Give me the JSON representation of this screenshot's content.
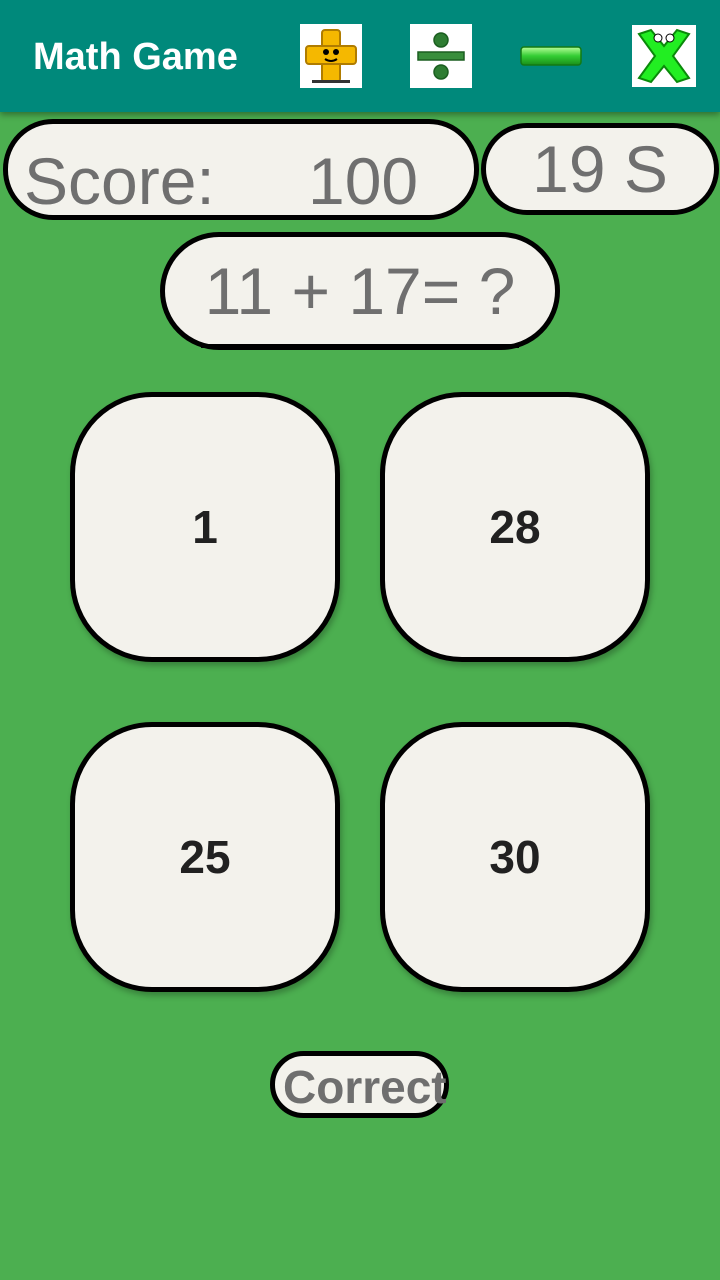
{
  "app": {
    "title": "Math Game"
  },
  "toolbar": {
    "icons": [
      {
        "name": "plus-icon",
        "color": "#f5b800"
      },
      {
        "name": "divide-icon",
        "color": "#2e7d32"
      },
      {
        "name": "minus-icon",
        "color": "#33cc33"
      },
      {
        "name": "multiply-icon",
        "color": "#22ee22"
      }
    ]
  },
  "score": {
    "label": "Score:",
    "value": "100"
  },
  "timer": {
    "text": "19 S"
  },
  "question": {
    "text": "11 + 17= ?"
  },
  "answers": [
    "1",
    "28",
    "25",
    "30"
  ],
  "status": {
    "text": "Correct"
  },
  "colors": {
    "background": "#4caf50",
    "appbar": "#00897b",
    "card": "#f3f2ec"
  }
}
